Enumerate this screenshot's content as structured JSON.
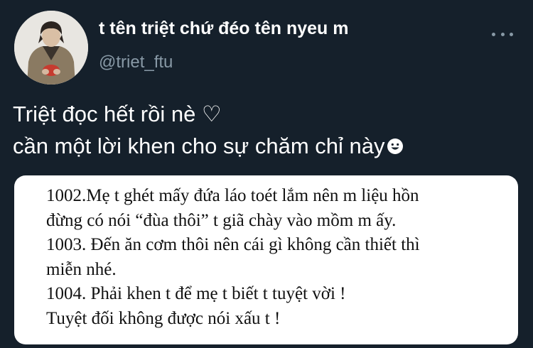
{
  "user": {
    "display_name": "t tên triệt chứ đéo tên nyeu m",
    "handle": "@triet_ftu",
    "avatar_icon": "profile-photo-icon"
  },
  "more_icon": "more-dots-icon",
  "tweet": {
    "lines": [
      "Triệt đọc hết rồi nè ♡",
      "cần một lời khen cho sự chăm chỉ này"
    ],
    "emoji_icon": "smiley-face-icon"
  },
  "media": {
    "lines": [
      "1002.Mẹ t ghét mấy đứa láo toét lắm nên m liệu hồn",
      "đừng có nói “đùa thôi” t giã chày vào mồm m ấy.",
      "1003. Đến ăn cơm thôi nên cái gì không cần thiết thì",
      "miễn nhé.",
      "1004. Phải khen t để mẹ t biết t tuyệt vời !",
      "Tuyệt đối không được nói xấu t !"
    ]
  },
  "colors": {
    "background": "#15202b",
    "text_primary": "#ffffff",
    "text_secondary": "#8899a6",
    "media_background": "#ffffff"
  }
}
